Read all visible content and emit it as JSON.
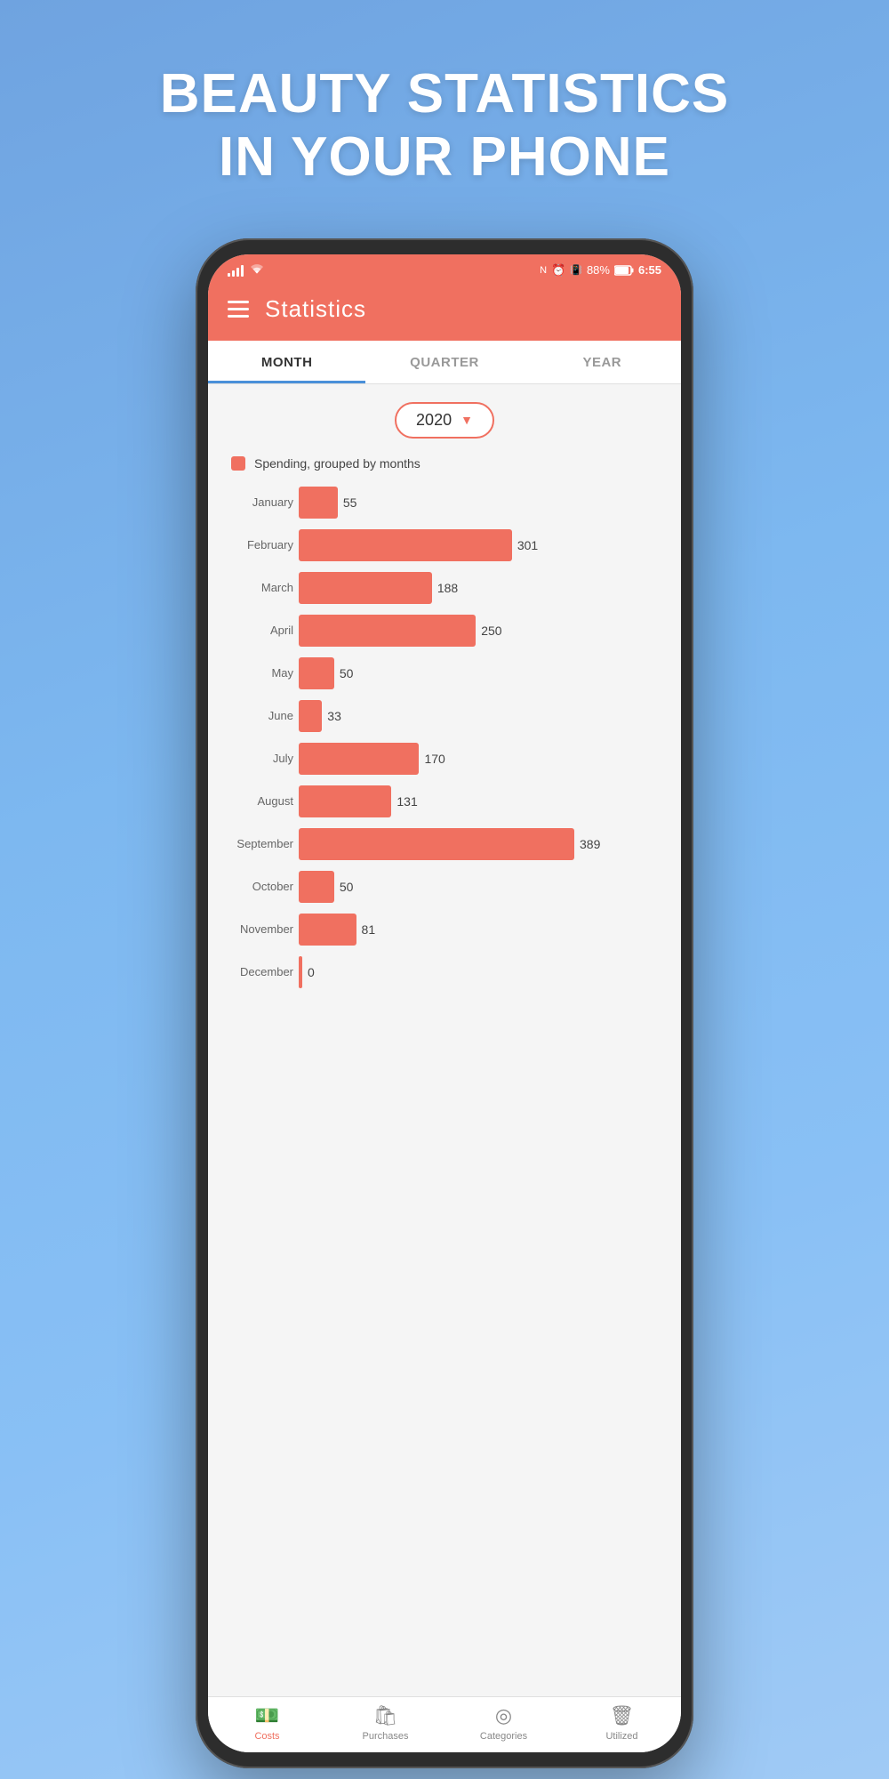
{
  "hero": {
    "title_line1": "BEAUTY STATISTICS",
    "title_line2": "IN YOUR PHONE"
  },
  "status_bar": {
    "battery_percent": "88%",
    "time": "6:55"
  },
  "header": {
    "title": "Statistics"
  },
  "tabs": [
    {
      "label": "MONTH",
      "active": true
    },
    {
      "label": "QUARTER",
      "active": false
    },
    {
      "label": "YEAR",
      "active": false
    }
  ],
  "year_selector": {
    "value": "2020"
  },
  "legend": {
    "text": "Spending, grouped by months"
  },
  "chart": {
    "max_value": 389,
    "bars": [
      {
        "month": "January",
        "value": 55
      },
      {
        "month": "February",
        "value": 301
      },
      {
        "month": "March",
        "value": 188
      },
      {
        "month": "April",
        "value": 250
      },
      {
        "month": "May",
        "value": 50
      },
      {
        "month": "June",
        "value": 33
      },
      {
        "month": "July",
        "value": 170
      },
      {
        "month": "August",
        "value": 131
      },
      {
        "month": "September",
        "value": 389
      },
      {
        "month": "October",
        "value": 50
      },
      {
        "month": "November",
        "value": 81
      },
      {
        "month": "December",
        "value": 0
      }
    ]
  },
  "bottom_nav": [
    {
      "label": "Costs",
      "icon": "💵",
      "active": true
    },
    {
      "label": "Purchases",
      "icon": "🛍",
      "active": false
    },
    {
      "label": "Categories",
      "icon": "◎",
      "active": false
    },
    {
      "label": "Utilized",
      "icon": "🗑",
      "active": false
    }
  ],
  "colors": {
    "accent": "#f07060",
    "active_tab": "#4a90d9"
  }
}
